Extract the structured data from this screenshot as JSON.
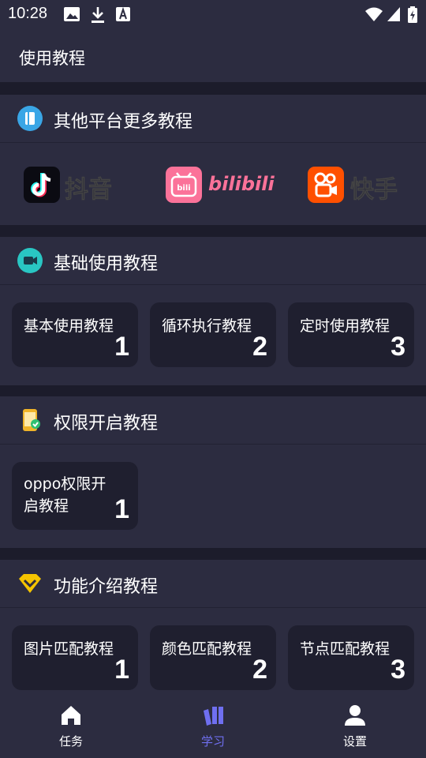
{
  "status": {
    "time": "10:28"
  },
  "appbar": {
    "title": "使用教程"
  },
  "platforms": {
    "title": "其他平台更多教程",
    "items": [
      {
        "name": "抖音",
        "icon": "douyin-logo-icon",
        "color": "#ffffff"
      },
      {
        "name": "bilibili",
        "icon": "bilibili-logo-icon",
        "color": "#fb7299"
      },
      {
        "name": "快手",
        "icon": "kuaishou-logo-icon",
        "color": "#ff5000"
      }
    ]
  },
  "basic": {
    "title": "基础使用教程",
    "cards": [
      {
        "label": "基本使用教程",
        "num": "1"
      },
      {
        "label": "循环执行教程",
        "num": "2"
      },
      {
        "label": "定时使用教程",
        "num": "3"
      }
    ]
  },
  "permission": {
    "title": "权限开启教程",
    "cards": [
      {
        "label": "oppo权限开启教程",
        "num": "1"
      }
    ]
  },
  "features": {
    "title": "功能介绍教程",
    "cards": [
      {
        "label": "图片匹配教程",
        "num": "1"
      },
      {
        "label": "颜色匹配教程",
        "num": "2"
      },
      {
        "label": "节点匹配教程",
        "num": "3"
      }
    ]
  },
  "nav": {
    "items": [
      {
        "label": "任务",
        "icon": "home-icon"
      },
      {
        "label": "学习",
        "icon": "books-icon",
        "active": true
      },
      {
        "label": "设置",
        "icon": "person-icon"
      }
    ],
    "active_color": "#6f6ff0",
    "inactive_color": "#ffffff"
  },
  "colors": {
    "background": "#1c1c2b",
    "surface": "#2c2c40",
    "card": "#1f1f2f"
  }
}
